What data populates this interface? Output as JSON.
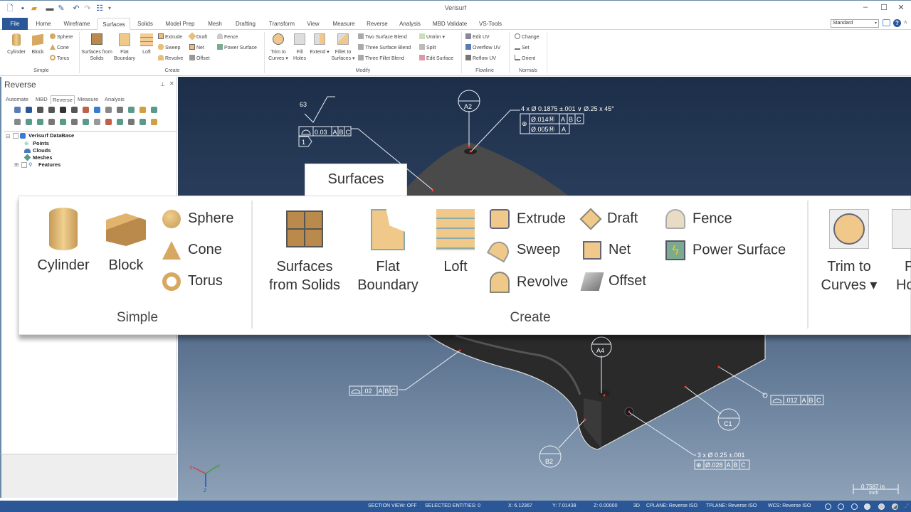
{
  "app": {
    "title": "Verisurf"
  },
  "quick_access": [
    {
      "icon": "new-file-icon",
      "glyph": "🗋"
    },
    {
      "icon": "save-icon",
      "glyph": "💾"
    },
    {
      "icon": "open-folder-icon",
      "glyph": "📂"
    },
    {
      "icon": "print-icon",
      "glyph": "🖶"
    },
    {
      "icon": "save-as-icon",
      "glyph": "✎"
    },
    {
      "icon": "undo-icon",
      "glyph": "↶"
    },
    {
      "icon": "redo-icon",
      "glyph": "↷"
    },
    {
      "icon": "properties-icon",
      "glyph": "☷"
    },
    {
      "icon": "customize-dropdown-icon",
      "glyph": "▾"
    }
  ],
  "window_controls": {
    "minimize": "–",
    "maximize": "☐",
    "close": "✕"
  },
  "tabs": [
    "File",
    "Home",
    "Wireframe",
    "Surfaces",
    "Solids",
    "Model Prep",
    "Mesh",
    "Drafting",
    "Transform",
    "View",
    "Measure",
    "Reverse",
    "Analysis",
    "MBD Validate",
    "VS-Tools"
  ],
  "active_tab": "Surfaces",
  "style_select": {
    "value": "Standard",
    "arrow": "▾"
  },
  "help": {
    "feedback": "💬",
    "help": "?",
    "collapse": "˄"
  },
  "ribbon": {
    "simple": {
      "label": "Simple",
      "large": [
        "Cylinder",
        "Block"
      ],
      "small": [
        "Sphere",
        "Cone",
        "Torus"
      ]
    },
    "create": {
      "label": "Create",
      "large": [
        "Surfaces from Solids",
        "Flat Boundary",
        "Loft"
      ],
      "small_col1": [
        "Extrude",
        "Sweep",
        "Revolve"
      ],
      "small_col2": [
        "Draft",
        "Net",
        "Offset"
      ],
      "small_col3": [
        "Fence",
        "Power Surface"
      ]
    },
    "modify": {
      "label": "Modify",
      "large": [
        "Trim to Curves ▾",
        "Fill Holes",
        "Extend ▾",
        "Fillet to Surfaces ▾"
      ],
      "small_col1": [
        "Two Surface Blend",
        "Three Surface Blend",
        "Three Fillet Blend"
      ],
      "small_col2": [
        "Untrim ▾",
        "Split",
        "Edit Surface"
      ]
    },
    "flowline": {
      "label": "Flowline",
      "small": [
        "Edit UV",
        "Overflow UV",
        "Reflow UV"
      ]
    },
    "normals": {
      "label": "Normals",
      "small": [
        "Change",
        "Set",
        "Orient"
      ]
    }
  },
  "panel": {
    "title": "Reverse",
    "pin": "⊥",
    "close": "✕",
    "tabs": [
      "Automate",
      "MBD",
      "Reverse",
      "Measure",
      "Analysis"
    ],
    "active_tab": "Reverse",
    "tree": {
      "root": "Verisurf DataBase",
      "children": [
        "Points",
        "Clouds",
        "Meshes",
        "Features"
      ],
      "expand": "⊟",
      "collapse": "⊞"
    }
  },
  "overlay": {
    "tab_label": "Surfaces",
    "simple": {
      "label": "Simple",
      "large": [
        "Cylinder",
        "Block"
      ],
      "small": [
        "Sphere",
        "Cone",
        "Torus"
      ]
    },
    "create": {
      "label": "Create",
      "large_1": [
        "Surfaces",
        "from Solids"
      ],
      "large_2": [
        "Flat",
        "Boundary"
      ],
      "large_3": "Loft",
      "col1": [
        "Extrude",
        "Sweep",
        "Revolve"
      ],
      "col2": [
        "Draft",
        "Net",
        "Offset"
      ],
      "col3": [
        "Fence",
        "Power Surface"
      ]
    },
    "modify_partial": {
      "trim_1": "Trim to",
      "trim_2": "Curves ▾",
      "fill_1": "F",
      "fill_2": "Ho"
    }
  },
  "annotations": {
    "surface_finish": "63",
    "profile_top": {
      "tol": "0.03",
      "datums": [
        "A",
        "B",
        "C"
      ],
      "tag": "1"
    },
    "hole_callout": "4 x Ø 0.1875 ±.001  ∨ Ø.25 x 45°",
    "position_row1": {
      "tol": "Ø.014Ⓜ",
      "datums": [
        "A",
        "B",
        "C"
      ]
    },
    "position_row2": {
      "tol": "Ø.005Ⓜ",
      "datums": [
        "A"
      ]
    },
    "datum_targets": [
      "A2",
      "A4",
      "B2",
      "C1"
    ],
    "profile_left": {
      "tol": ".02",
      "datums": [
        "A",
        "B",
        "C"
      ]
    },
    "profile_right": {
      "tol": ".012",
      "datums": [
        "A",
        "B",
        "C"
      ]
    },
    "hole_callout_2": "3 x Ø 0.25 ±.001",
    "position_row3": {
      "tol": "Ø.028",
      "datums": [
        "A",
        "B",
        "C"
      ]
    }
  },
  "triad": {
    "x": "X",
    "y": "Y",
    "z": "Z"
  },
  "scale_bar": {
    "value": "0.7587 in",
    "unit": "Inch"
  },
  "status": {
    "section_view": "SECTION VIEW: OFF",
    "selected": "SELECTED ENTITIES: 0",
    "x": "X:   6.12367",
    "y": "Y:   7.01438",
    "z": "Z:   0.00000",
    "mode": "3D",
    "cplane": "CPLANE: Reverse ISO",
    "tplane": "TPLANE: Reverse ISO",
    "wcs": "WCS: Reverse ISO"
  },
  "colors": {
    "accent": "#2b5797",
    "icon_tan": "#e8bf7a",
    "icon_dark": "#c69a55",
    "annotation": "#ffffff",
    "probe_point": "#ff3030"
  }
}
